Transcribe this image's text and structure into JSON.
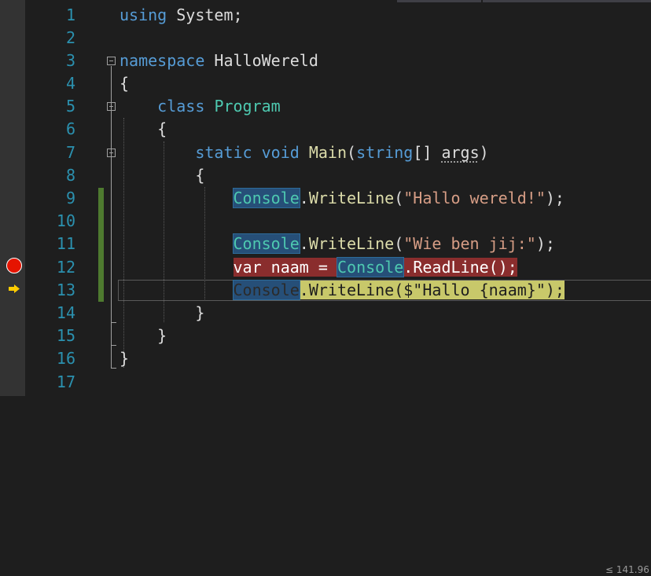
{
  "editor": {
    "lines": [
      {
        "n": "1"
      },
      {
        "n": "2"
      },
      {
        "n": "3"
      },
      {
        "n": "4"
      },
      {
        "n": "5"
      },
      {
        "n": "6"
      },
      {
        "n": "7"
      },
      {
        "n": "8"
      },
      {
        "n": "9"
      },
      {
        "n": "10"
      },
      {
        "n": "11"
      },
      {
        "n": "12"
      },
      {
        "n": "13"
      },
      {
        "n": "14"
      },
      {
        "n": "15"
      },
      {
        "n": "16"
      },
      {
        "n": "17"
      }
    ],
    "tok": {
      "using": "using",
      "system": "System",
      "semi": ";",
      "namespace": "namespace",
      "ns_name": "HalloWereld",
      "lbrace": "{",
      "rbrace": "}",
      "class": "class",
      "program": "Program",
      "static": "static",
      "void": "void",
      "main": "Main",
      "lparen": "(",
      "string": "string",
      "brackets": "[]",
      "args": "args",
      "rparen": ")",
      "console": "Console",
      "dot": ".",
      "writeline": "WriteLine",
      "readline": "ReadLine",
      "str_hallo": "\"Hallo wereld!\"",
      "str_wie": "\"Wie ben jij:\"",
      "str_interp": "$\"Hallo {naam}\"",
      "close_call": ");",
      "var": "var",
      "naam": "naam",
      "eq": "=",
      "empty_call": "();"
    },
    "perf_tip": "≤ 141.96"
  },
  "colors": {
    "background": "#1e1e1e",
    "keyword": "#569cd6",
    "type": "#4ec9b0",
    "method": "#dcdcaa",
    "string": "#d69d85",
    "line_number": "#2b91af",
    "breakpoint": "#e51400",
    "current_statement": "#c8c86a"
  },
  "icons": {
    "breakpoint": "breakpoint-icon",
    "execution_arrow": "current-statement-arrow-icon"
  }
}
